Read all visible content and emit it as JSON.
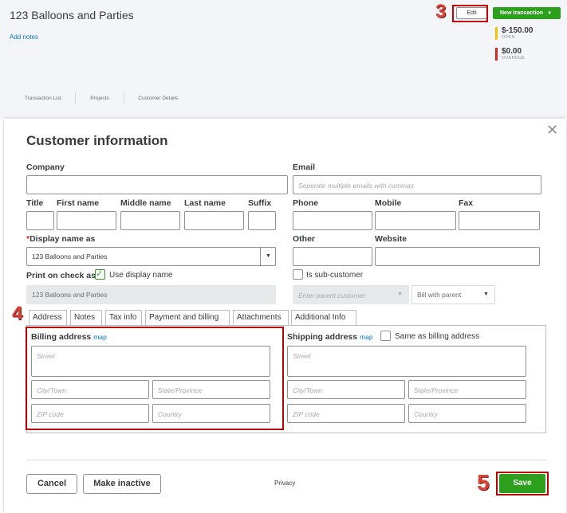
{
  "customer_page": {
    "title": "123 Balloons and Parties",
    "add_notes": "Add notes",
    "edit_label": "Edit",
    "new_transaction_label": "New transaction",
    "open_amount": "$-150.00",
    "open_label": "OPEN",
    "overdue_amount": "$0.00",
    "overdue_label": "OVERDUE",
    "tabs": [
      "Transaction List",
      "Projects",
      "Customer Details"
    ],
    "colors": {
      "open": "#f4c400",
      "overdue": "#d52b1e",
      "primary": "#2ca01c"
    }
  },
  "steps": {
    "edit": "3",
    "address": "4",
    "save": "5"
  },
  "modal": {
    "title": "Customer information",
    "close_icon": "close-icon",
    "company_label": "Company",
    "company_value": "",
    "email_label": "Email",
    "email_placeholder": "Seperate multiple emails with commas",
    "title_label": "Title",
    "first_name_label": "First name",
    "middle_name_label": "Middle name",
    "last_name_label": "Last name",
    "suffix_label": "Suffix",
    "phone_label": "Phone",
    "mobile_label": "Mobile",
    "fax_label": "Fax",
    "required_mark": "*",
    "display_name_label": "Display name as",
    "display_name_value": "123 Balloons and Parties",
    "other_label": "Other",
    "website_label": "Website",
    "print_on_check_label": "Print on check as",
    "use_display_name_label": "Use display name",
    "print_on_check_value": "123 Balloons and Parties",
    "sub_customer_label": "Is sub-customer",
    "parent_customer_placeholder": "Enter parent customer",
    "bill_with_parent": "Bill with parent",
    "tabs": [
      "Address",
      "Notes",
      "Tax info",
      "Payment and billing",
      "Attachments",
      "Additional Info"
    ],
    "billing": {
      "heading": "Billing address",
      "map": "map",
      "street": "Street",
      "city": "City/Town",
      "state": "State/Province",
      "zip": "ZIP code",
      "country": "Country"
    },
    "shipping": {
      "heading": "Shipping address",
      "map": "map",
      "same_as": "Same as billing address",
      "street": "Street",
      "city": "City/Town",
      "state": "State/Province",
      "zip": "ZIP code",
      "country": "Country"
    },
    "cancel_label": "Cancel",
    "make_inactive_label": "Make inactive",
    "privacy_label": "Privacy",
    "save_label": "Save"
  }
}
